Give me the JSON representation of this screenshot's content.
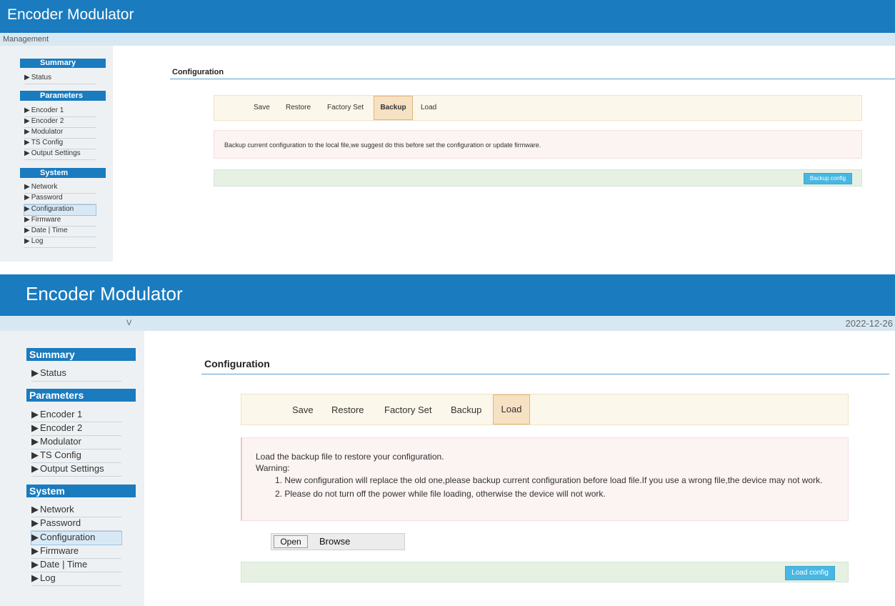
{
  "app": {
    "title": "Encoder Modulator"
  },
  "panel1": {
    "subbar_text": "Management",
    "sidebar": {
      "summary": {
        "title": "Summary",
        "items": [
          "Status"
        ]
      },
      "parameters": {
        "title": "Parameters",
        "items": [
          "Encoder 1",
          "Encoder 2",
          "Modulator",
          "TS Config",
          "Output Settings"
        ]
      },
      "system": {
        "title": "System",
        "items": [
          "Network",
          "Password",
          "Configuration",
          "Firmware",
          "Date | Time",
          "Log"
        ]
      }
    },
    "content_title": "Configuration",
    "tabs": [
      "Save",
      "Restore",
      "Factory Set",
      "Backup",
      "Load"
    ],
    "active_tab": "Backup",
    "info_text": "Backup current configuration to the local file,we suggest do this before set the configuration or update firmware.",
    "button": "Backup config"
  },
  "panel2": {
    "subbar_left": "V",
    "subbar_date": "2022-12-26",
    "sidebar": {
      "summary": {
        "title": "Summary",
        "items": [
          "Status"
        ]
      },
      "parameters": {
        "title": "Parameters",
        "items": [
          "Encoder 1",
          "Encoder 2",
          "Modulator",
          "TS Config",
          "Output Settings"
        ]
      },
      "system": {
        "title": "System",
        "items": [
          "Network",
          "Password",
          "Configuration",
          "Firmware",
          "Date | Time",
          "Log"
        ]
      }
    },
    "content_title": "Configuration",
    "tabs": [
      "Save",
      "Restore",
      "Factory Set",
      "Backup",
      "Load"
    ],
    "active_tab": "Load",
    "info": {
      "line1": "Load the backup file to restore your configuration.",
      "line2": "Warning:",
      "item1": "1. New configuration will replace the old one,please backup current configuration before load file.If you use a wrong file,the device may not work.",
      "item2": "2. Please do not turn off the power while file loading, otherwise the device will not work."
    },
    "file_input": {
      "open": "Open",
      "browse": "Browse"
    },
    "button": "Load config"
  },
  "icons": {
    "nav_marker": "triangle-right-icon",
    "nav_marker_glyph": "▶"
  },
  "colors": {
    "header": "#1a7bbf",
    "subbar": "#d7e8f2",
    "button": "#48b7e2"
  }
}
